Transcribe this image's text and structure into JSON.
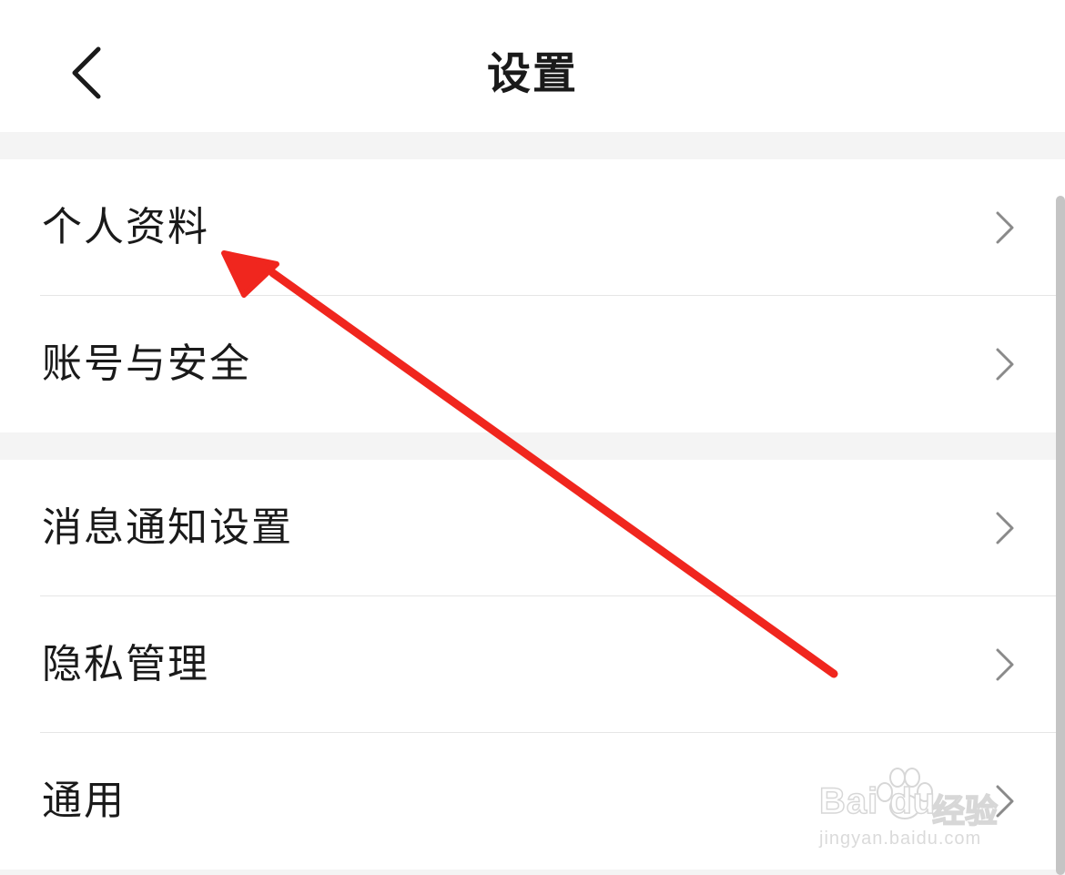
{
  "header": {
    "title": "设置",
    "back_icon": "chevron-left-icon"
  },
  "groups": [
    {
      "items": [
        {
          "label": "个人资料",
          "icon": "chevron-right-icon"
        },
        {
          "label": "账号与安全",
          "icon": "chevron-right-icon"
        }
      ]
    },
    {
      "items": [
        {
          "label": "消息通知设置",
          "icon": "chevron-right-icon"
        },
        {
          "label": "隐私管理",
          "icon": "chevron-right-icon"
        },
        {
          "label": "通用",
          "icon": "chevron-right-icon"
        }
      ]
    }
  ],
  "annotation": {
    "type": "red-arrow",
    "color": "#f0261e",
    "points_to": "个人资料"
  },
  "watermark": {
    "brand": "Bai du",
    "product": "经验",
    "url": "jingyan.baidu.com"
  },
  "colors": {
    "background": "#ffffff",
    "separator": "#f4f4f4",
    "text": "#1a1a1a",
    "chevron": "#8a8a8a",
    "divider": "#e6e6e6"
  }
}
